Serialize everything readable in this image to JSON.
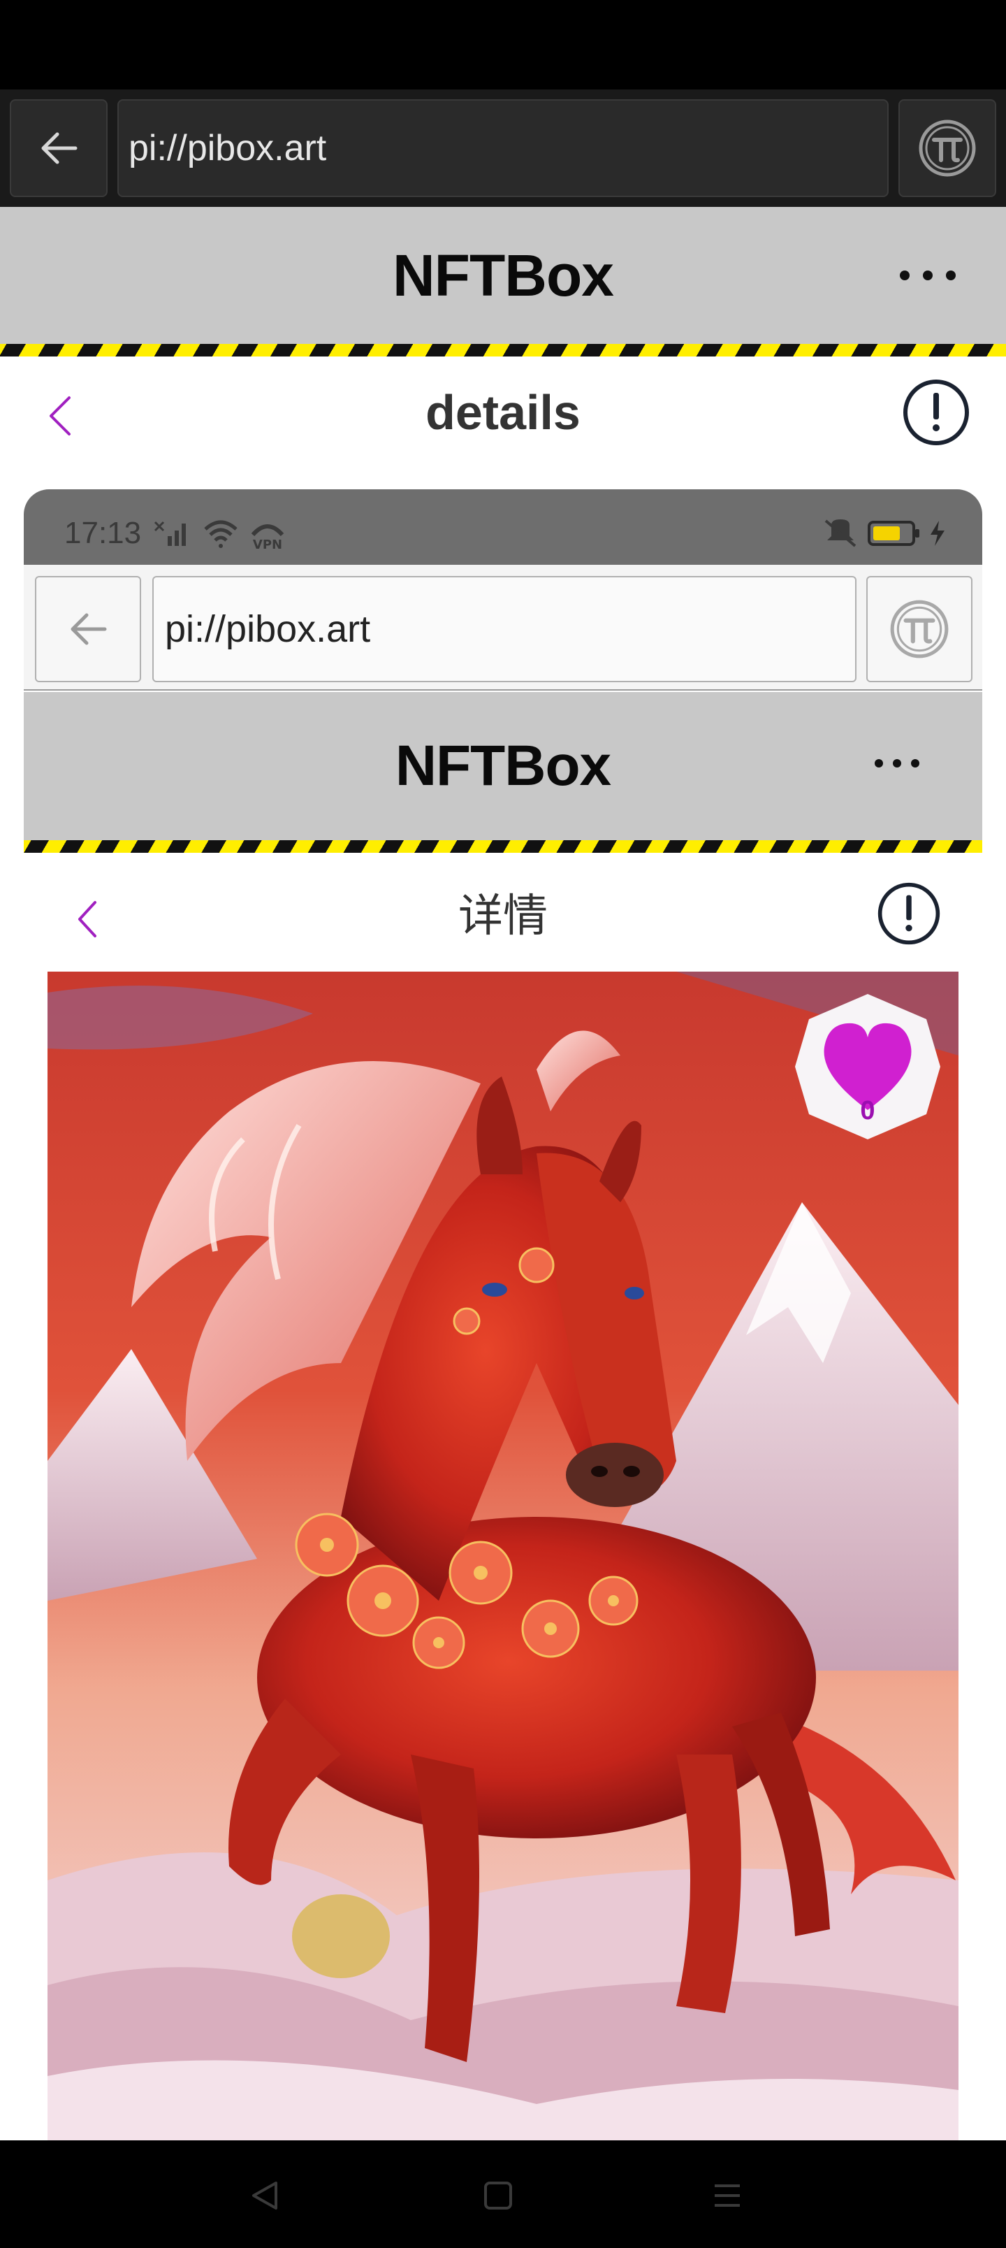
{
  "browser": {
    "url": "pi://pibox.art",
    "back_icon": "arrow-left-icon",
    "pi_icon": "pi-logo-icon"
  },
  "app": {
    "title": "NFTBox",
    "menu_icon": "more-horizontal-icon"
  },
  "page": {
    "title": "details",
    "back_icon": "chevron-left-icon",
    "info_icon": "exclamation-circle-icon"
  },
  "screenshot": {
    "status_time": "17:13",
    "status_icons": [
      "signal-off-icon",
      "wifi-icon",
      "vpn-icon",
      "mute-vibrate-icon",
      "battery-icon",
      "charging-icon"
    ],
    "url": "pi://pibox.art",
    "app_title": "NFTBox",
    "page_title": "详情",
    "like_count": "0"
  },
  "colors": {
    "accent_purple": "#a020c0",
    "like_heart": "#d020d0",
    "header_gray": "#c8c8c8",
    "hazard_yellow": "#ffee00"
  },
  "system_nav": {
    "back_icon": "triangle-back-icon",
    "home_icon": "square-home-icon",
    "recents_icon": "menu-lines-icon"
  }
}
